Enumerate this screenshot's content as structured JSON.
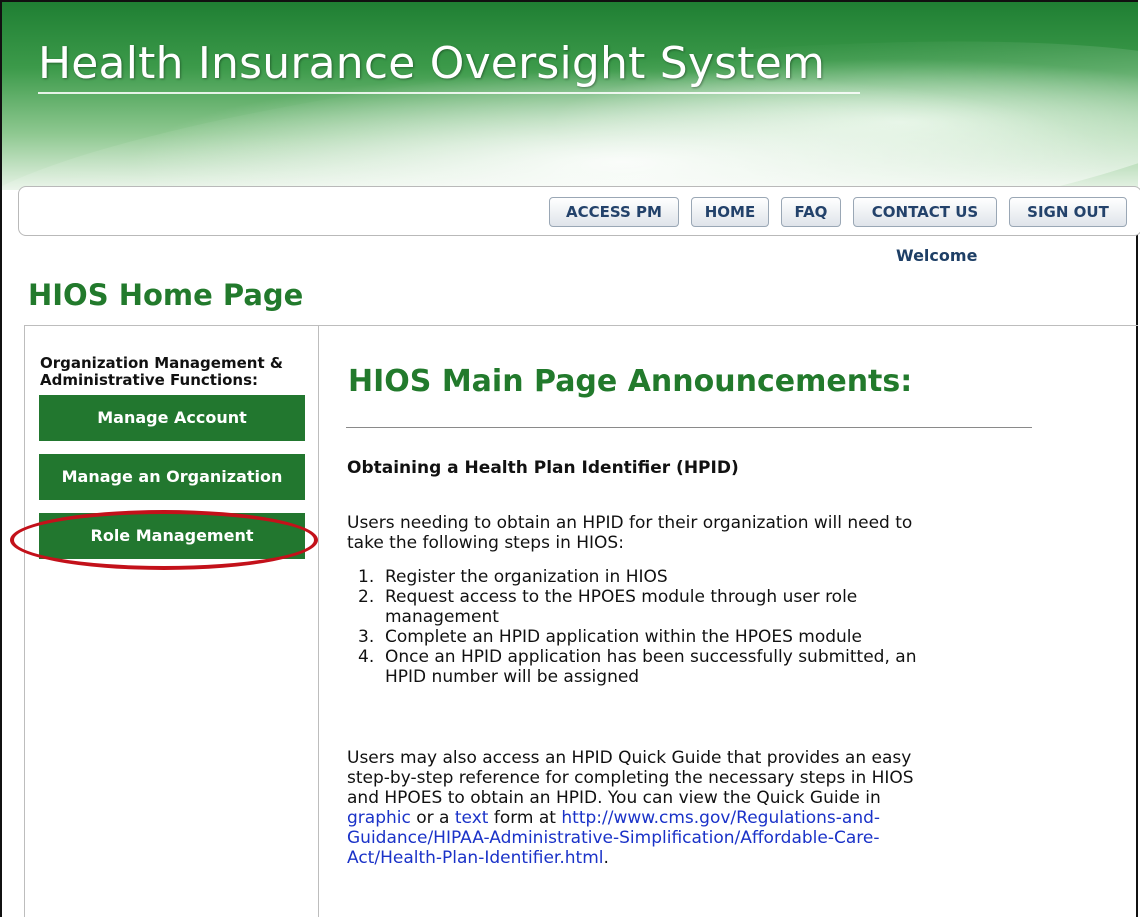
{
  "header": {
    "title": "Health Insurance Oversight System"
  },
  "nav": {
    "items": [
      {
        "label": "ACCESS PM"
      },
      {
        "label": "HOME"
      },
      {
        "label": "FAQ"
      },
      {
        "label": "CONTACT US"
      },
      {
        "label": "SIGN OUT"
      }
    ],
    "welcome": "Welcome"
  },
  "page": {
    "title": "HIOS Home Page"
  },
  "sidebar": {
    "heading_line1": "Organization Management &",
    "heading_line2": "Administrative Functions:",
    "buttons": [
      {
        "label": "Manage Account"
      },
      {
        "label": "Manage an Organization"
      },
      {
        "label": "Role Management"
      }
    ]
  },
  "main": {
    "heading": "HIOS Main Page Announcements:",
    "section_title": "Obtaining a Health Plan Identifier (HPID)",
    "intro_line1": "Users needing to obtain an HPID for their organization will need to",
    "intro_line2": "take the following steps in HIOS:",
    "steps": [
      {
        "num": "1.",
        "line1": "Register the organization in HIOS",
        "line2": ""
      },
      {
        "num": "2.",
        "line1": "Request access to the HPOES module through user role",
        "line2": "management"
      },
      {
        "num": "3.",
        "line1": "Complete an HPID application within the HPOES module",
        "line2": ""
      },
      {
        "num": "4.",
        "line1": "Once an HPID application has been successfully submitted, an",
        "line2": "HPID number will be assigned"
      }
    ],
    "guide_line1": "Users may also access an HPID Quick Guide that provides an easy",
    "guide_line2": "step-by-step reference for completing the necessary steps in HIOS",
    "guide_line3": "and HPOES to obtain an HPID. You can view the Quick Guide in",
    "link_graphic": "graphic",
    "text_or_a": " or a ",
    "link_text": "text",
    "text_form_at": " form at ",
    "link_url_part1": "http://www.cms.gov/Regulations-and-",
    "link_url_part2": "Guidance/HIPAA-Administrative-Simplification/Affordable-Care-",
    "link_url_part3": "Act/Health-Plan-Identifier.html",
    "period": "."
  },
  "colors": {
    "brand_green": "#227a2c",
    "button_green": "#22772f",
    "nav_text": "#23426b",
    "link": "#1a32c8",
    "highlight": "#c3111a"
  }
}
